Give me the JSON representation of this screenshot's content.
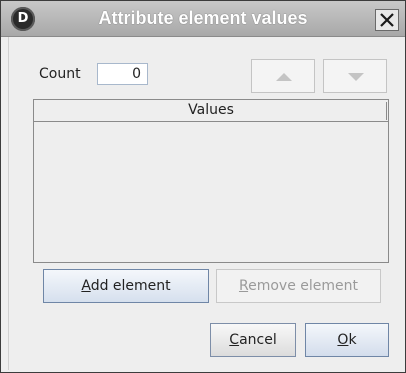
{
  "window": {
    "title": "Attribute element values",
    "app_icon_letter": "D",
    "close_icon": "close-x-icon"
  },
  "count": {
    "label": "Count",
    "value": "0"
  },
  "reorder": {
    "up_icon": "triangle-up-icon",
    "down_icon": "triangle-down-icon"
  },
  "table": {
    "columns": [
      "Values"
    ],
    "rows": []
  },
  "actions": {
    "add": {
      "mnemonic": "A",
      "rest": "dd element"
    },
    "remove": {
      "mnemonic": "R",
      "rest": "emove element"
    },
    "cancel": {
      "mnemonic": "C",
      "rest": "ancel"
    },
    "ok": {
      "mnemonic": "O",
      "rest": "k"
    }
  },
  "colors": {
    "titlebar": "#a8a8a8",
    "title_text": "#ffffff",
    "panel": "#eeeeee",
    "default_button_border": "#6f86a6",
    "disabled_text": "#9a9a9a"
  }
}
